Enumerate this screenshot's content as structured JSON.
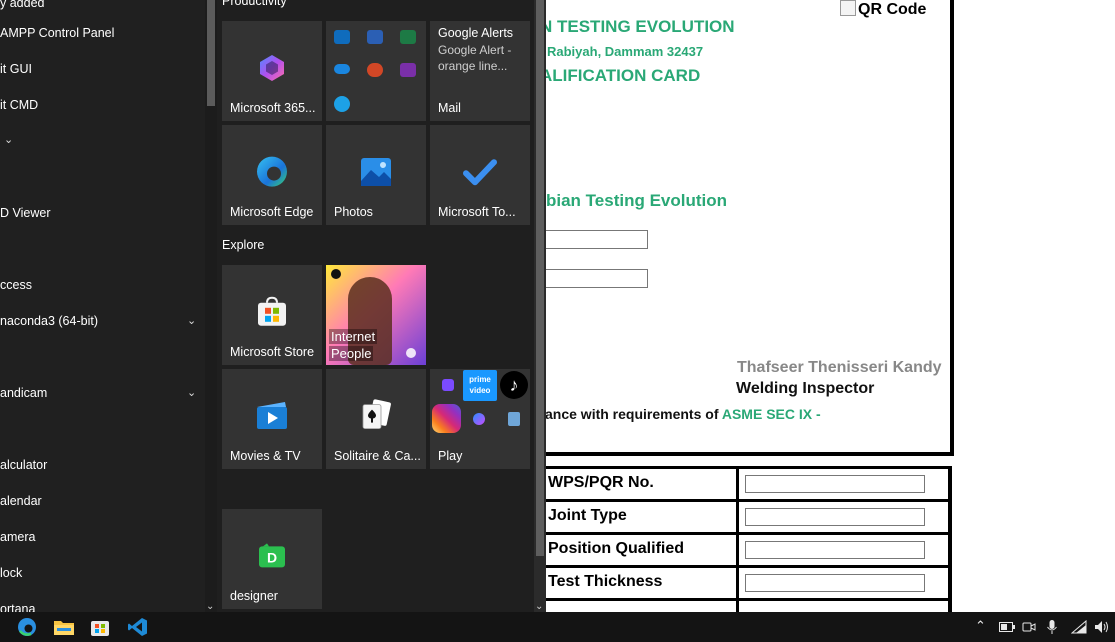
{
  "start_menu": {
    "applist": [
      {
        "label": "y added",
        "expandable": false
      },
      {
        "label": "AMPP Control Panel",
        "expandable": false
      },
      {
        "label": "it GUI",
        "expandable": false
      },
      {
        "label": "it CMD",
        "expandable": false
      },
      {
        "label": "",
        "expandable": true
      },
      {
        "label": "D Viewer",
        "expandable": false
      },
      {
        "label": "ccess",
        "expandable": false
      },
      {
        "label": "naconda3 (64-bit)",
        "expandable": true
      },
      {
        "label": "andicam",
        "expandable": true
      },
      {
        "label": "alculator",
        "expandable": false
      },
      {
        "label": "alendar",
        "expandable": false
      },
      {
        "label": "amera",
        "expandable": false
      },
      {
        "label": "lock",
        "expandable": false
      },
      {
        "label": "ortana",
        "expandable": false
      }
    ],
    "groups": {
      "productivity": "Productivity",
      "explore": "Explore"
    },
    "tiles": {
      "m365": "Microsoft 365...",
      "mail": {
        "title": "Google Alerts",
        "line1": "Google Alert -",
        "line2": "orange line...",
        "label": "Mail"
      },
      "edge": "Microsoft Edge",
      "photos": "Photos",
      "todo": "Microsoft To...",
      "store": "Microsoft Store",
      "spotify": {
        "overlay1": "Internet",
        "overlay2": "People"
      },
      "movies": "Movies & TV",
      "solitaire": "Solitaire & Ca...",
      "play": "Play",
      "designer": "designer"
    }
  },
  "webpage": {
    "company": "N TESTING EVOLUTION",
    "address": "Rabiyah, Dammam 32437",
    "card_title": "ALIFICATION CARD",
    "company2": "bian Testing Evolution",
    "qr_alt": "QR Code",
    "inspector_name": "Thafseer Thenisseri Kandy",
    "inspector_title": "Welding Inspector",
    "compliance_text": "ance with requirements of ",
    "compliance_std": "ASME SEC IX -",
    "table_rows": [
      "WPS/PQR No.",
      "Joint Type",
      "Position Qualified",
      "Test Thickness"
    ]
  },
  "colors": {
    "accent_green": "#2aa876",
    "menu_bg": "#1f1f1f",
    "tile_bg": "#333333",
    "taskbar_bg": "#141414"
  }
}
